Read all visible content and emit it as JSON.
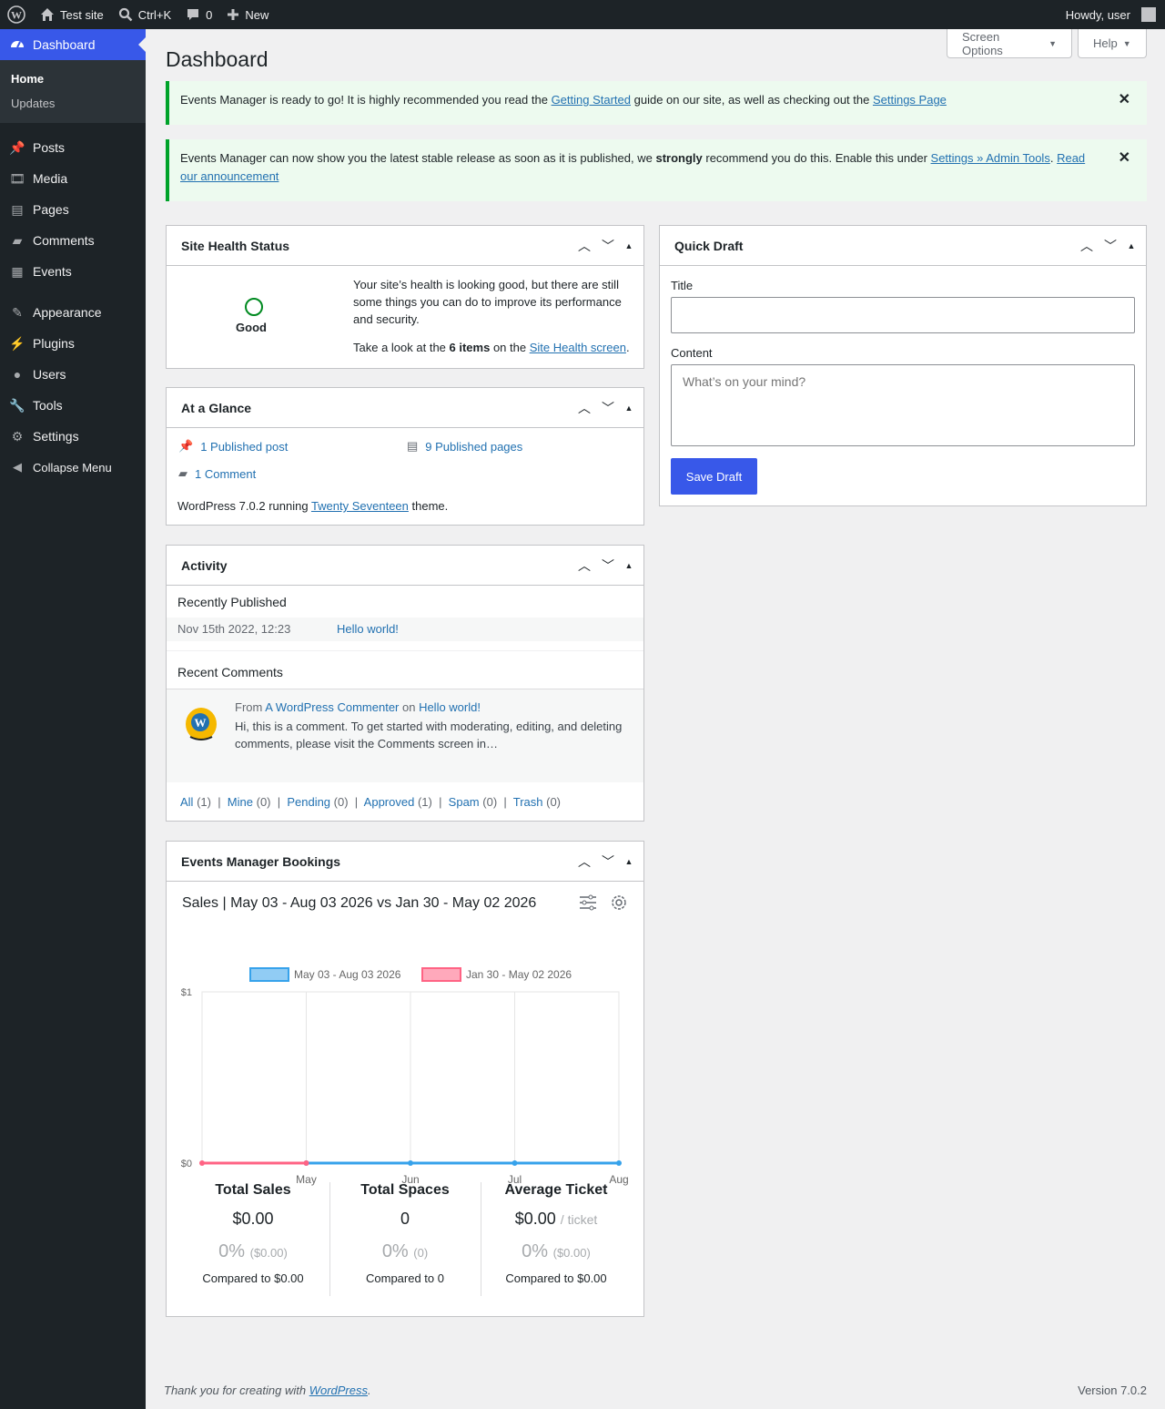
{
  "adminbar": {
    "site_name": "Test site",
    "search_shortcut": "Ctrl+K",
    "comments_count": "0",
    "new_label": "New",
    "howdy": "Howdy, user"
  },
  "sidebar": {
    "dashboard": "Dashboard",
    "submenu": [
      "Home",
      "Updates"
    ],
    "items": [
      "Posts",
      "Media",
      "Pages",
      "Comments",
      "Events",
      "Appearance",
      "Plugins",
      "Users",
      "Tools",
      "Settings"
    ],
    "collapse": "Collapse Menu"
  },
  "header": {
    "title": "Dashboard",
    "screen_options": "Screen Options",
    "help": "Help"
  },
  "notices": {
    "n1": {
      "pre": "Events Manager is ready to go! It is highly recommended you read the ",
      "link1": "Getting Started",
      "mid": " guide on our site, as well as checking out the ",
      "link2": "Settings Page"
    },
    "n2": {
      "pre": "Events Manager can now show you the latest stable release as soon as it is published, we ",
      "strong": "strongly",
      "mid": " recommend you do this. Enable this under ",
      "link1": "Settings » Admin Tools",
      "dot": ".",
      "link2": "Read our announcement"
    }
  },
  "site_health": {
    "title": "Site Health Status",
    "status": "Good",
    "desc": "Your site’s health is looking good, but there are still some things you can do to improve its performance and security.",
    "items_pre": "Take a look at the ",
    "items_count": "6 items",
    "items_mid": " on the ",
    "items_link": "Site Health screen",
    "items_post": "."
  },
  "glance": {
    "title": "At a Glance",
    "posts": "1 Published post",
    "pages": "9 Published pages",
    "comments": "1 Comment",
    "version_pre": "WordPress 7.0.2 running ",
    "theme": "Twenty Seventeen",
    "version_post": " theme."
  },
  "activity": {
    "title": "Activity",
    "recently_published": "Recently Published",
    "pub_date": "Nov 15th 2022, 12:23",
    "pub_title": "Hello world!",
    "recent_comments": "Recent Comments",
    "from": "From ",
    "author": "A WordPress Commenter",
    "on": " on ",
    "post": "Hello world!",
    "text": "Hi, this is a comment. To get started with moderating, editing, and deleting comments, please visit the Comments screen in…",
    "filters": [
      {
        "label": "All",
        "count": "(1)"
      },
      {
        "label": "Mine",
        "count": "(0)"
      },
      {
        "label": "Pending",
        "count": "(0)"
      },
      {
        "label": "Approved",
        "count": "(1)"
      },
      {
        "label": "Spam",
        "count": "(0)"
      },
      {
        "label": "Trash",
        "count": "(0)"
      }
    ]
  },
  "bookings": {
    "title": "Events Manager Bookings",
    "chart_title": "Sales | May 03 - Aug 03 2026 vs Jan 30 - May 02 2026",
    "stats": [
      {
        "title": "Total Sales",
        "value": "$0.00",
        "unit": "",
        "pct": "0%",
        "pct_detail": "($0.00)",
        "compare": "Compared to $0.00"
      },
      {
        "title": "Total Spaces",
        "value": "0",
        "unit": "",
        "pct": "0%",
        "pct_detail": "(0)",
        "compare": "Compared to 0"
      },
      {
        "title": "Average Ticket",
        "value": "$0.00",
        "unit": "/ ticket",
        "pct": "0%",
        "pct_detail": "($0.00)",
        "compare": "Compared to $0.00"
      }
    ]
  },
  "quick_draft": {
    "title": "Quick Draft",
    "title_label": "Title",
    "title_value": "",
    "content_label": "Content",
    "content_placeholder": "What’s on your mind?",
    "save": "Save Draft"
  },
  "footer": {
    "thanks_pre": "Thank you for creating with ",
    "thanks_link": "WordPress",
    "thanks_post": ".",
    "version": "Version 7.0.2"
  },
  "chart_data": {
    "type": "line",
    "x": [
      "",
      "May",
      "Jun",
      "Jul",
      "Aug"
    ],
    "y_ticks": [
      "$0",
      "$1"
    ],
    "ylim": [
      0,
      1
    ],
    "grid": true,
    "legend_position": "top",
    "series": [
      {
        "name": "May 03 - Aug 03 2026",
        "color": "#36a2eb",
        "values": [
          null,
          0,
          0,
          0,
          0
        ]
      },
      {
        "name": "Jan 30 - May 02 2026",
        "color": "#ff6384",
        "values": [
          0,
          0,
          null,
          null,
          null
        ]
      }
    ]
  },
  "colors": {
    "accent": "#3858e9",
    "notice_border": "#00a32a",
    "health_good": "#008a20"
  }
}
